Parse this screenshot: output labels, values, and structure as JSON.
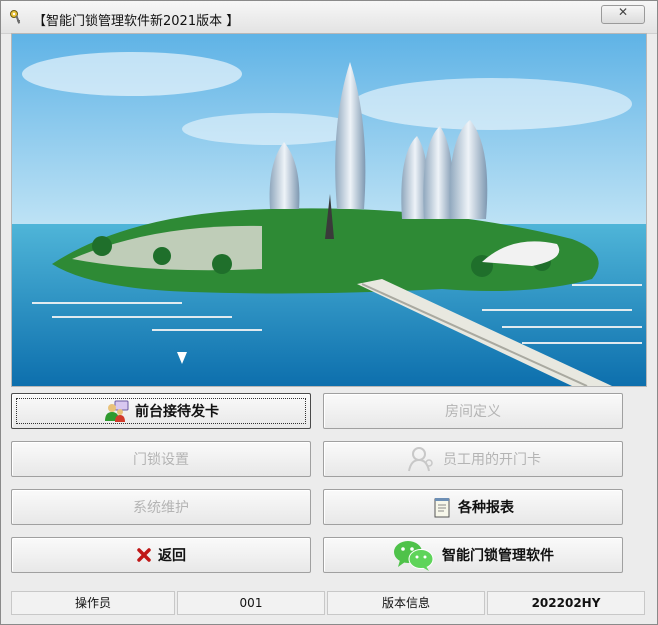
{
  "window": {
    "title": "【智能门锁管理软件新2021版本 】",
    "close_label": "✕",
    "icon": "key-icon"
  },
  "buttons": {
    "reception": {
      "label": "前台接待发卡",
      "icon": "people-card-icon",
      "enabled": true
    },
    "room_definition": {
      "label": "房间定义",
      "enabled": false
    },
    "lock_settings": {
      "label": "门锁设置",
      "enabled": false
    },
    "staff_card": {
      "label": "员工用的开门卡",
      "icon": "staff-icon",
      "enabled": false
    },
    "system_maintenance": {
      "label": "系统维护",
      "enabled": false
    },
    "reports": {
      "label": "各种报表",
      "icon": "notepad-icon",
      "enabled": true
    },
    "back": {
      "label": "返回",
      "icon": "red-x-icon",
      "enabled": true
    },
    "smart_lock": {
      "label": "智能门锁管理软件",
      "icon": "wechat-icon",
      "enabled": true
    }
  },
  "status": {
    "operator_label": "操作员",
    "operator_value": "001",
    "version_label": "版本信息",
    "version_value": "202202HY"
  },
  "colors": {
    "sky": "#7fc4ea",
    "sea": "#1f8fc6",
    "island_green": "#2e8a35",
    "disabled_text": "#b4b4b4"
  }
}
